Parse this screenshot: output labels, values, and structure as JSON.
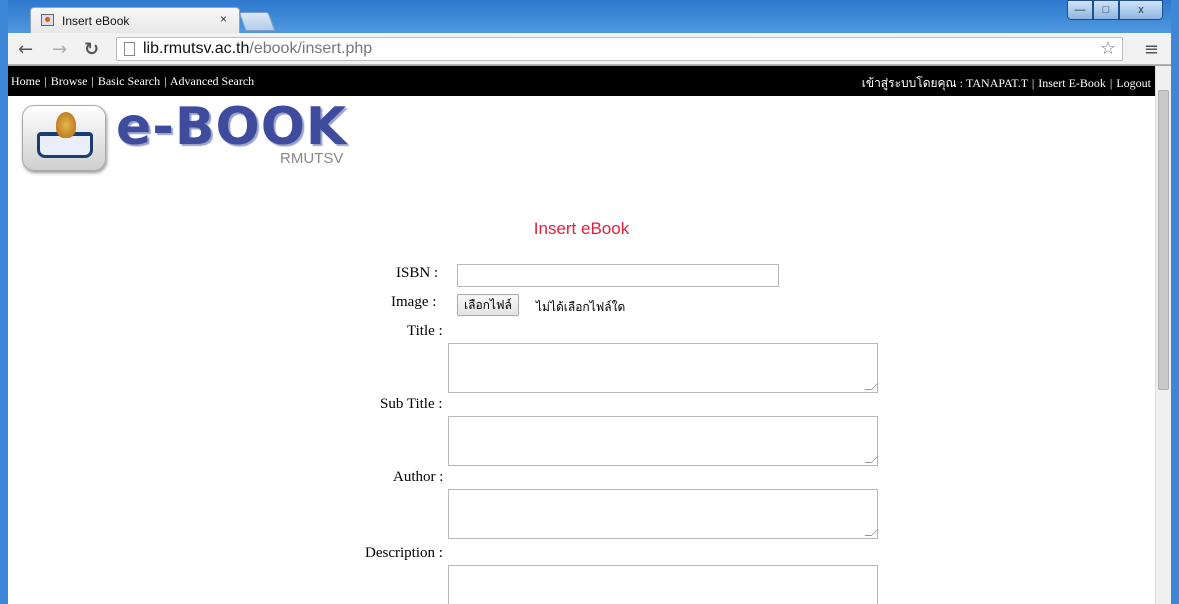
{
  "browser": {
    "tab_title": "Insert eBook",
    "tab_close": "×",
    "url_host": "lib.rmutsv.ac.th",
    "url_path": "/ebook/insert.php",
    "window_controls": {
      "minimize": "—",
      "maximize": "□",
      "close": "x"
    }
  },
  "nav": {
    "home": "Home",
    "browse": "Browse",
    "basic_search": "Basic Search",
    "advanced_search": "Advanced Search",
    "separator": "|",
    "logged_in_text": "เข้าสู่ระบบโดยคุณ : TANAPAT.T",
    "insert_ebook": "Insert E-Book",
    "logout": "Logout"
  },
  "logo": {
    "title": "e-BOOK",
    "subtitle": "RMUTSV"
  },
  "form": {
    "title": "Insert eBook",
    "isbn_label": "ISBN :",
    "isbn_value": "",
    "image_label": "Image :",
    "file_button": "เลือกไฟล์",
    "file_status": "ไม่ได้เลือกไฟล์ใด",
    "title_label": "Title :",
    "subtitle_label": "Sub Title :",
    "author_label": "Author :",
    "description_label": "Description :"
  },
  "icons": {
    "back": "back-arrow-icon",
    "forward": "forward-arrow-icon",
    "reload": "reload-icon",
    "bookmark": "star-icon",
    "menu": "hamburger-menu-icon"
  }
}
